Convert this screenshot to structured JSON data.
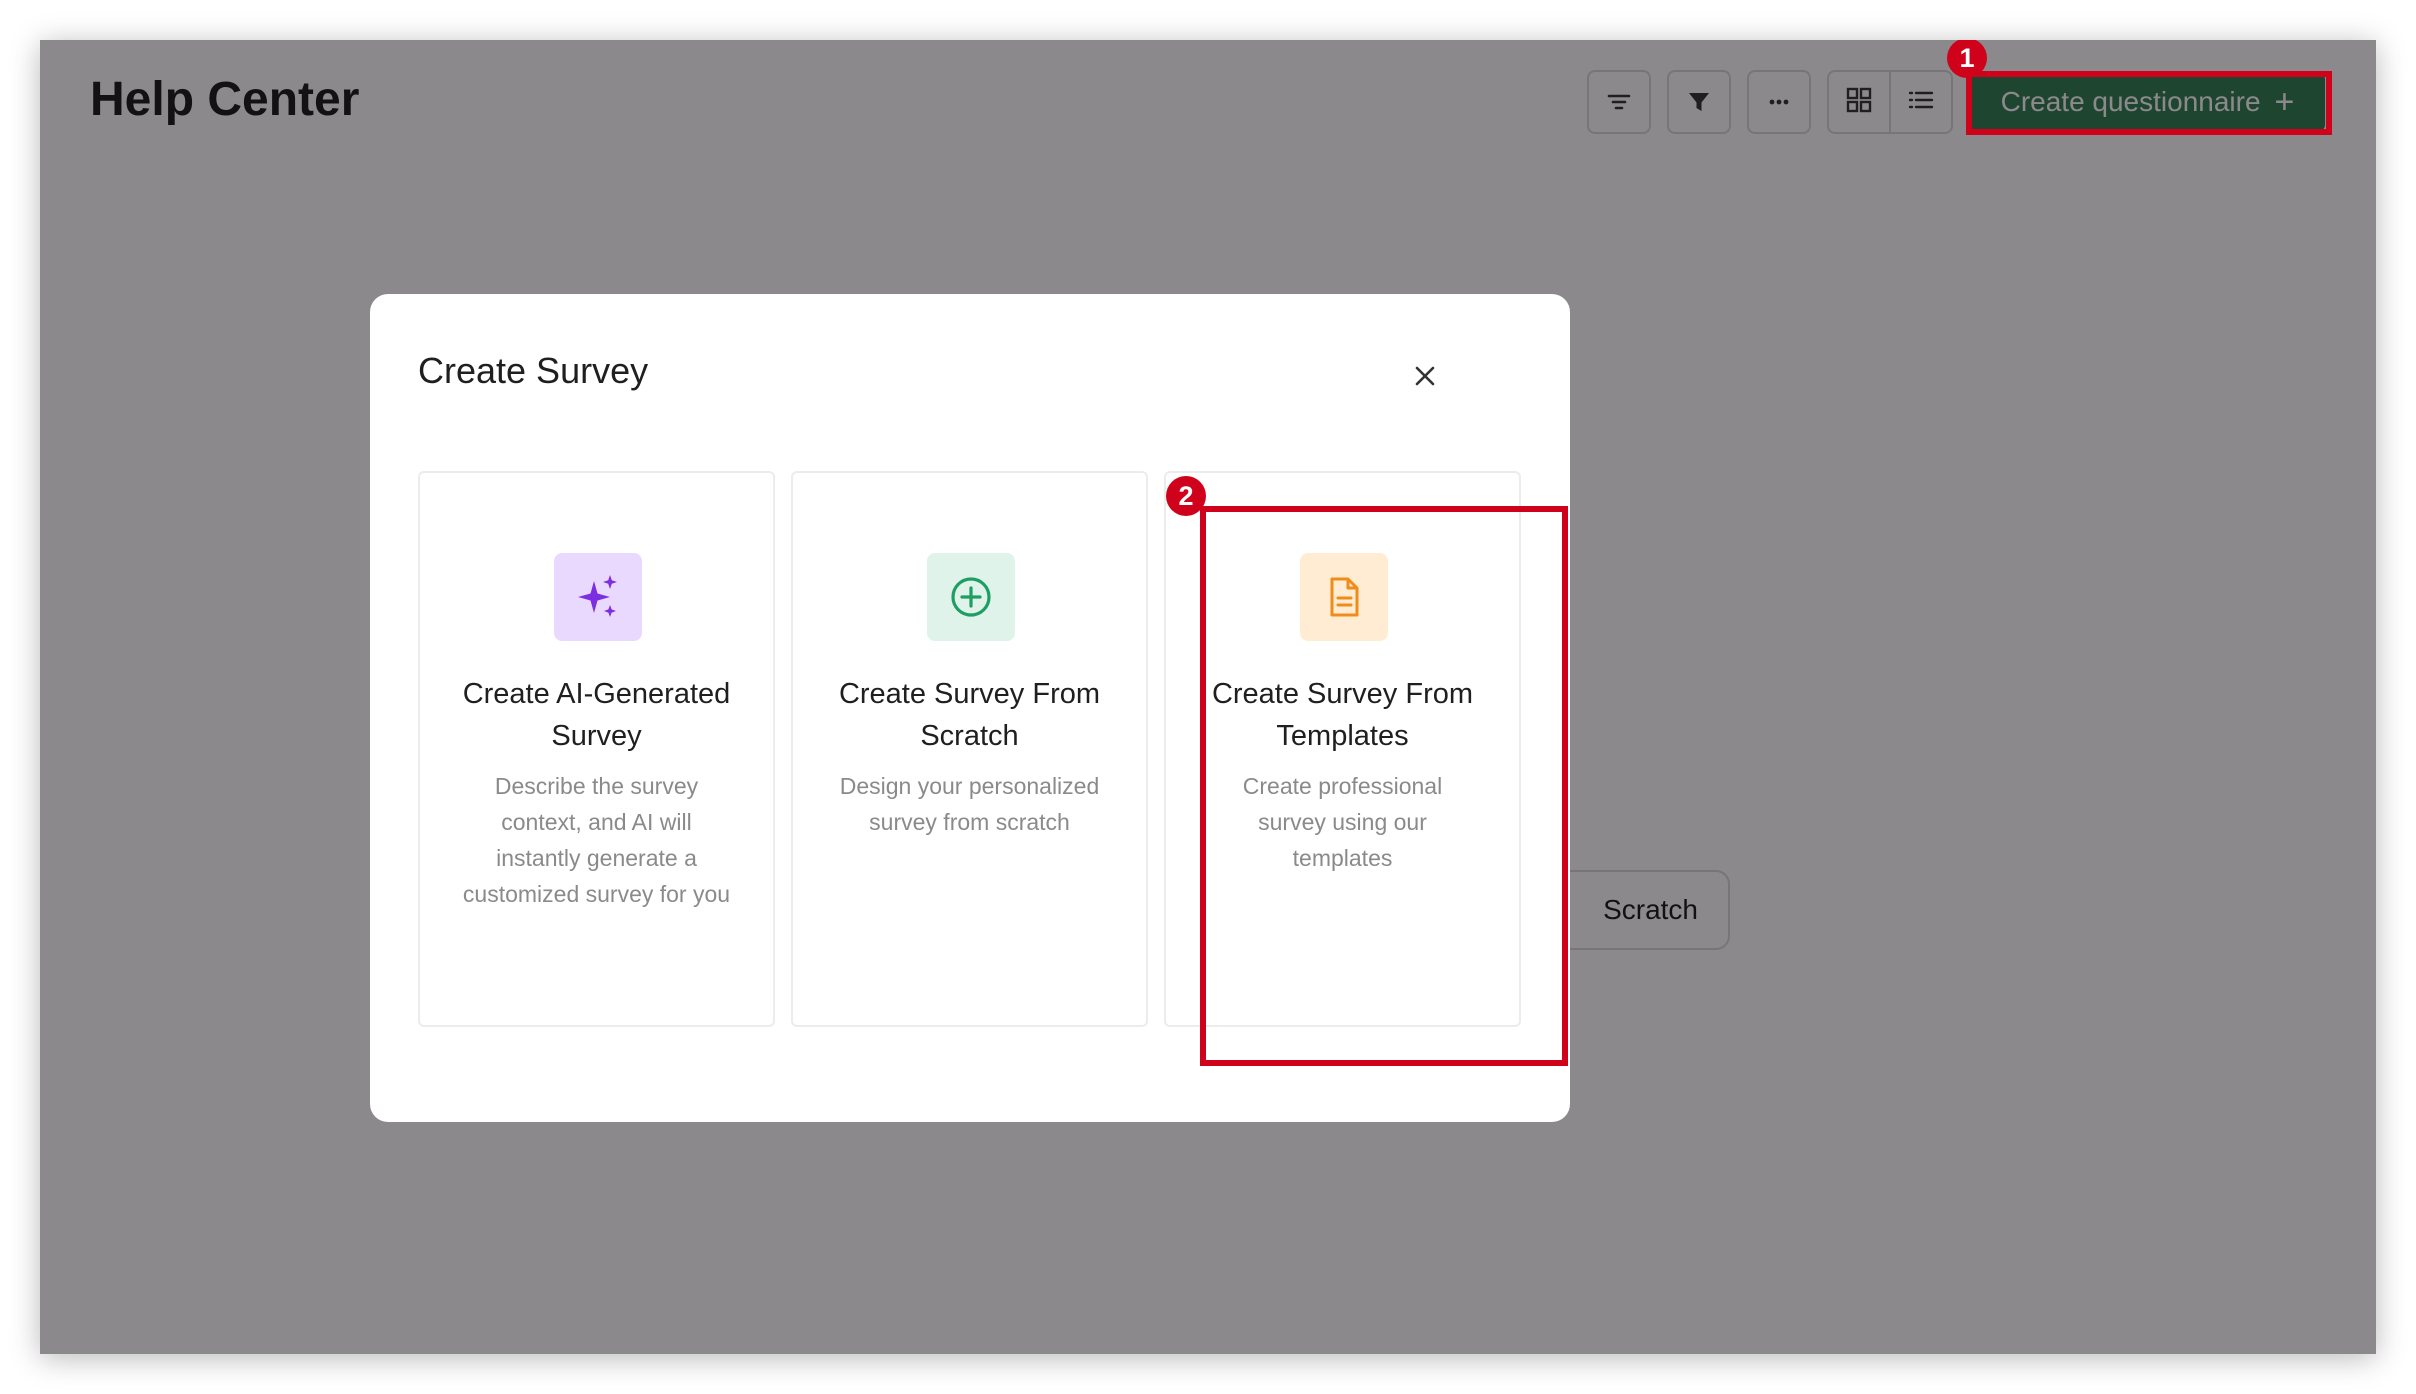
{
  "page": {
    "title": "Help Center",
    "background_button_label": "Scratch"
  },
  "toolbar": {
    "create_label": "Create questionnaire",
    "create_plus": "+",
    "create_color": "#2e7d4f",
    "icons": [
      "sort-icon",
      "filter-icon",
      "more-icon",
      "grid-view-icon",
      "list-view-icon"
    ]
  },
  "modal": {
    "title": "Create Survey",
    "options": [
      {
        "title": "Create AI-Generated Survey",
        "description": "Describe the survey context, and AI will instantly generate a customized survey for you",
        "icon": "sparkles-icon",
        "icon_color": "#7b2fe0",
        "icon_bg": "#ead9ff"
      },
      {
        "title": "Create Survey From Scratch",
        "description": "Design your personalized survey from scratch",
        "icon": "plus-circle-icon",
        "icon_color": "#1f9e63",
        "icon_bg": "#dff3ea"
      },
      {
        "title": "Create Survey From Templates",
        "description": "Create professional survey using our templates",
        "icon": "document-icon",
        "icon_color": "#f08c1a",
        "icon_bg": "#ffecd2"
      }
    ]
  },
  "annotations": [
    {
      "label": "1",
      "color": "#d0021b"
    },
    {
      "label": "2",
      "color": "#d0021b"
    }
  ]
}
